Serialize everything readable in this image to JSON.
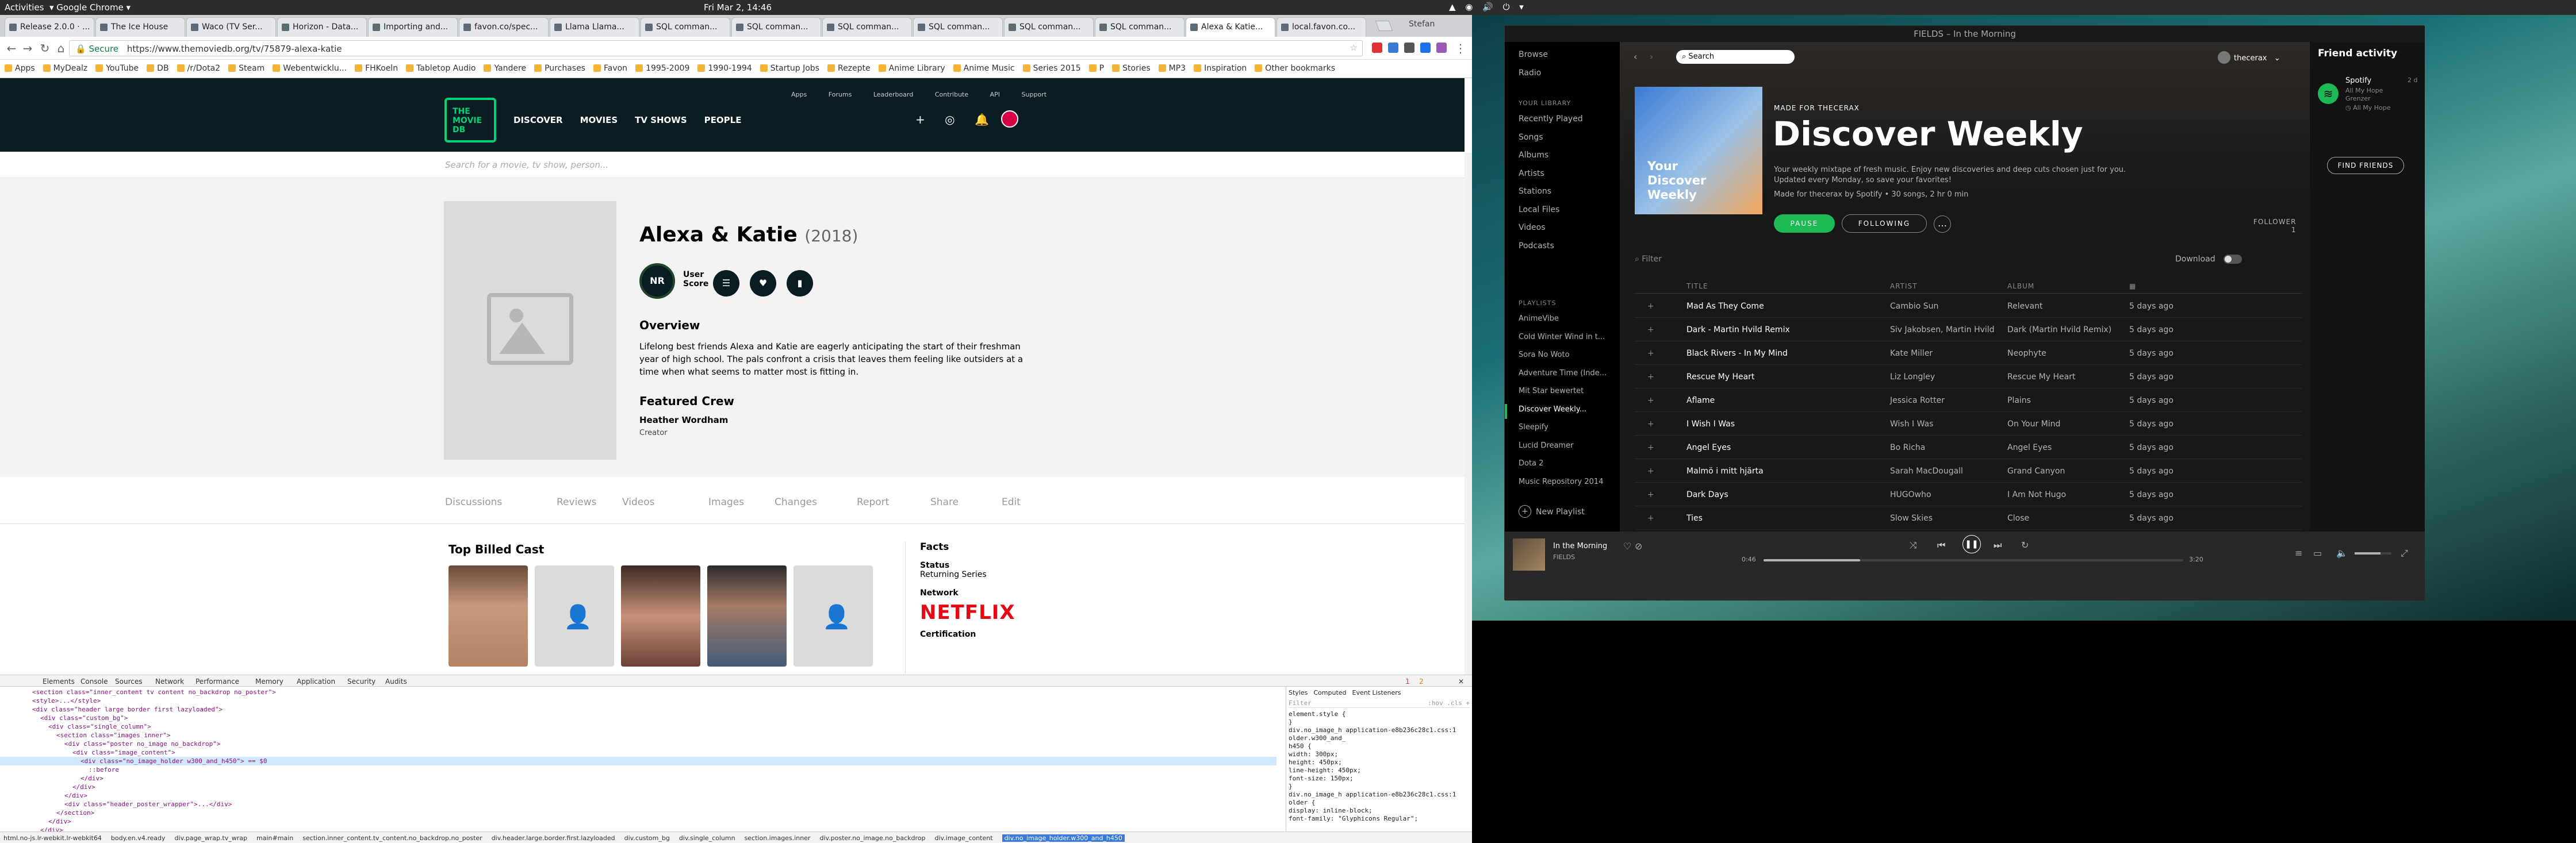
{
  "topbar": {
    "activities": "Activities",
    "app": "Google Chrome",
    "clock": "Fri Mar  2, 14:46"
  },
  "browser": {
    "tabs": [
      "Release 2.0.0 · ...",
      "The Ice House",
      "Waco (TV Ser...",
      "Horizon - Data...",
      "Importing and...",
      "favon.co/spec...",
      "Llama Llama...",
      "SQL comman...",
      "SQL comman...",
      "SQL comman...",
      "SQL comman...",
      "SQL comman...",
      "SQL comman...",
      "Alexa & Katie...",
      "local.favon.co..."
    ],
    "active_tab_index": 13,
    "user": "Stefan",
    "secure_label": "Secure",
    "url": "https://www.themoviedb.org/tv/75879-alexa-katie",
    "bookmarks": [
      "Apps",
      "MyDealz",
      "YouTube",
      "DB",
      "/r/Dota2",
      "Steam",
      "Webentwicklu...",
      "FHKoeln",
      "Tabletop Audio",
      "Yandere",
      "Purchases",
      "Favon",
      "1995-2009",
      "1990-1994",
      "Startup Jobs",
      "Rezepte",
      "Anime Library",
      "Anime Music",
      "Series 2015",
      "P",
      "Stories",
      "MP3",
      "Inspiration",
      "Other bookmarks"
    ]
  },
  "tmdb": {
    "sublinks": [
      "Apps",
      "Forums",
      "Leaderboard",
      "Contribute",
      "API",
      "Support"
    ],
    "logo": "THE MOVIE DB",
    "nav": [
      "DISCOVER",
      "MOVIES",
      "TV SHOWS",
      "PEOPLE"
    ],
    "search_placeholder": "Search for a movie, tv show, person...",
    "title": "Alexa & Katie",
    "year": "(2018)",
    "rating": "NR",
    "user_score_label": "User Score",
    "overview_heading": "Overview",
    "overview": "Lifelong best friends Alexa and Katie are eagerly anticipating the start of their freshman year of high school. The pals confront a crisis that leaves them feeling like outsiders at a time when what seems to matter most is fitting in.",
    "featured_crew_heading": "Featured Crew",
    "crew_name": "Heather Wordham",
    "crew_job": "Creator",
    "tabs": [
      "Discussions",
      "Reviews",
      "Videos",
      "Images",
      "Changes",
      "Report",
      "Share",
      "Edit"
    ],
    "cast_heading": "Top Billed Cast",
    "facts_heading": "Facts",
    "status_label": "Status",
    "status_value": "Returning Series",
    "network_label": "Network",
    "network_value": "NETFLIX",
    "certification_label": "Certification"
  },
  "devtools": {
    "tabs": [
      "Elements",
      "Console",
      "Sources",
      "Network",
      "Performance",
      "Memory",
      "Application",
      "Security",
      "Audits"
    ],
    "errors": "1",
    "warnings": "2",
    "code_lines": [
      "<section class=\"inner_content tv content no_backdrop no_poster\">",
      "<style>...</style>",
      "<div class=\"header large border first lazyloaded\">",
      "<div class=\"custom_bg\">",
      "<div class=\"single_column\">",
      "<section class=\"images inner\">",
      "<div class=\"poster no_image no_backdrop\">",
      "<div class=\"image_content\">",
      "<div class=\"no_image_holder w300_and_h450\"> == $0",
      "::before",
      "</div>",
      "</div>",
      "</div>",
      "<div class=\"header_poster_wrapper\">...</div>",
      "</section>",
      "</div>",
      "</div>"
    ],
    "styles_tabs": [
      "Styles",
      "Computed",
      "Event Listeners"
    ],
    "filter_placeholder": "Filter",
    "filter_opts": ":hov  .cls  +",
    "styles_lines": [
      "element.style {",
      "}",
      "div.no_image_h  application-e8b236c28c1.css:1",
      "older.w300_and_",
      "h450 {",
      "  width: 300px;",
      "  height: 450px;",
      "  line-height: 450px;",
      "  font-size: 150px;",
      "}",
      "div.no_image_h  application-e8b236c28c1.css:1",
      "older {",
      "  display: inline-block;",
      "  font-family: \"Glyphicons Regular\";"
    ],
    "crumbs": [
      "html.no-js.lr-webkit.lr-webkit64",
      "body.en.v4.ready",
      "div.page_wrap.tv_wrap",
      "main#main",
      "section.inner_content.tv_content.no_backdrop.no_poster",
      "div.header.large.border.first.lazyloaded",
      "div.custom_bg",
      "div.single_column",
      "section.images.inner",
      "div.poster.no_image.no_backdrop",
      "div.image_content",
      "div.no_image_holder.w300_and_h450"
    ]
  },
  "spotify": {
    "window_title": "FIELDS – In the Morning",
    "sidebar_top": [
      "Browse",
      "Radio"
    ],
    "library_heading": "YOUR LIBRARY",
    "library": [
      "Recently Played",
      "Songs",
      "Albums",
      "Artists",
      "Stations",
      "Local Files",
      "Videos",
      "Podcasts"
    ],
    "playlists_heading": "PLAYLISTS",
    "playlists": [
      "AnimeVibe",
      "Cold Winter Wind in t...",
      "Sora No Woto",
      "Adventure Time (Inde...",
      "Mit Star bewertet",
      "Discover Weekly...",
      "Sleepify",
      "Lucid Dreamer",
      "Dota 2",
      "Music Repository 2014"
    ],
    "new_playlist": "New Playlist",
    "search_placeholder": "Search",
    "user": "thecerax",
    "cover_text": "Your Discover Weekly",
    "made_for": "MADE FOR THECERAX",
    "playlist_title": "Discover Weekly",
    "description": "Your weekly mixtape of fresh music. Enjoy new discoveries and deep cuts chosen just for you. Updated every Monday, so save your favorites!",
    "meta": "Made for thecerax by Spotify • 30 songs, 2 hr 0 min",
    "pause_label": "PAUSE",
    "following_label": "FOLLOWING",
    "followers_label": "FOLLOWER",
    "followers_count": "1",
    "filter_placeholder": "Filter",
    "download_label": "Download",
    "columns": [
      "TITLE",
      "ARTIST",
      "ALBUM"
    ],
    "tracks": [
      {
        "title": "Mad As They Come",
        "artist": "Cambio Sun",
        "album": "Relevant",
        "added": "5 days ago"
      },
      {
        "title": "Dark - Martin Hvild Remix",
        "artist": "Siv Jakobsen, Martin Hvild",
        "album": "Dark (Martin Hvild Remix)",
        "added": "5 days ago"
      },
      {
        "title": "Black Rivers - In My Mind",
        "artist": "Kate Miller",
        "album": "Neophyte",
        "added": "5 days ago"
      },
      {
        "title": "Rescue My Heart",
        "artist": "Liz Longley",
        "album": "Rescue My Heart",
        "added": "5 days ago"
      },
      {
        "title": "Aflame",
        "artist": "Jessica Rotter",
        "album": "Plains",
        "added": "5 days ago"
      },
      {
        "title": "I Wish I Was",
        "artist": "Wish I Was",
        "album": "On Your Mind",
        "added": "5 days ago"
      },
      {
        "title": "Angel Eyes",
        "artist": "Bo Richa",
        "album": "Angel Eyes",
        "added": "5 days ago"
      },
      {
        "title": "Malmö i mitt hjärta",
        "artist": "Sarah MacDougall",
        "album": "Grand Canyon",
        "added": "5 days ago"
      },
      {
        "title": "Dark Days",
        "artist": "HUGOwho",
        "album": "I Am Not Hugo",
        "added": "5 days ago"
      },
      {
        "title": "Ties",
        "artist": "Slow Skies",
        "album": "Close",
        "added": "5 days ago"
      }
    ],
    "friends_heading": "Friend activity",
    "friend_name": "Spotify",
    "friend_time": "2 d",
    "friend_track": "All My Hope",
    "friend_artist": "Grenzer",
    "friend_ctx": "All My Hope",
    "find_friends": "FIND FRIENDS",
    "now_playing_title": "In the Morning",
    "now_playing_artist": "FIELDS",
    "elapsed": "0:46",
    "duration": "3:20",
    "progress": 0.23,
    "volume": 0.7
  }
}
